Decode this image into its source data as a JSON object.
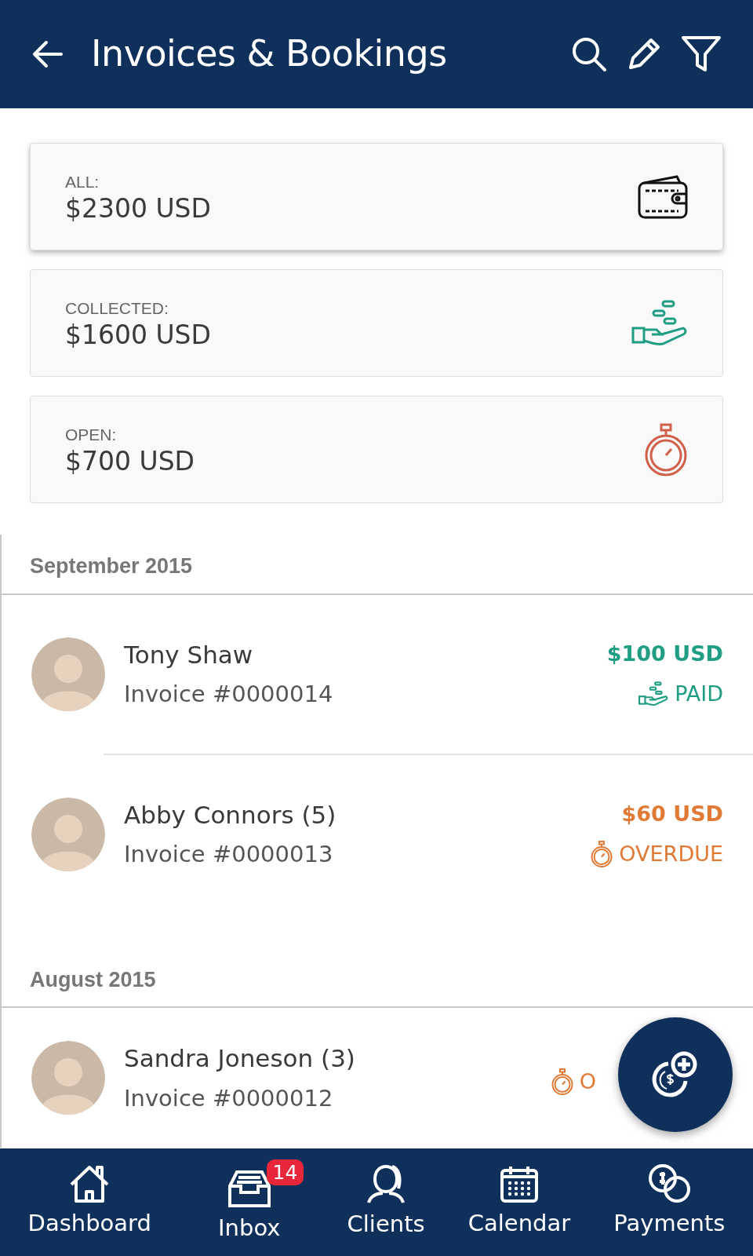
{
  "app_bar": {
    "title": "Invoices & Bookings"
  },
  "summary_cards": [
    {
      "label": "ALL:",
      "amount": "$2300 USD",
      "kind": "wallet",
      "selected": true
    },
    {
      "label": "COLLECTED:",
      "amount": "$1600 USD",
      "kind": "collected",
      "selected": false
    },
    {
      "label": "OPEN:",
      "amount": "$700 USD",
      "kind": "open",
      "selected": false
    }
  ],
  "sections": [
    {
      "title": "September 2015",
      "invoices": [
        {
          "name": "Tony Shaw",
          "invoice": "Invoice #0000014",
          "amount": "$100 USD",
          "status": "PAID",
          "kind": "paid"
        },
        {
          "name": "Abby Connors (5)",
          "invoice": "Invoice #0000013",
          "amount": "$60 USD",
          "status": "OVERDUE",
          "kind": "overdue"
        }
      ]
    },
    {
      "title": "August 2015",
      "invoices": [
        {
          "name": "Sandra Joneson (3)",
          "invoice": "Invoice #0000012",
          "status": "O",
          "kind": "overdue"
        }
      ]
    }
  ],
  "bottom_nav": [
    {
      "label": "Dashboard",
      "kind": "home"
    },
    {
      "label": "Inbox",
      "kind": "inbox",
      "badge": "14"
    },
    {
      "label": "Clients",
      "kind": "clients"
    },
    {
      "label": "Calendar",
      "kind": "calendar"
    },
    {
      "label": "Payments",
      "kind": "payments"
    }
  ]
}
